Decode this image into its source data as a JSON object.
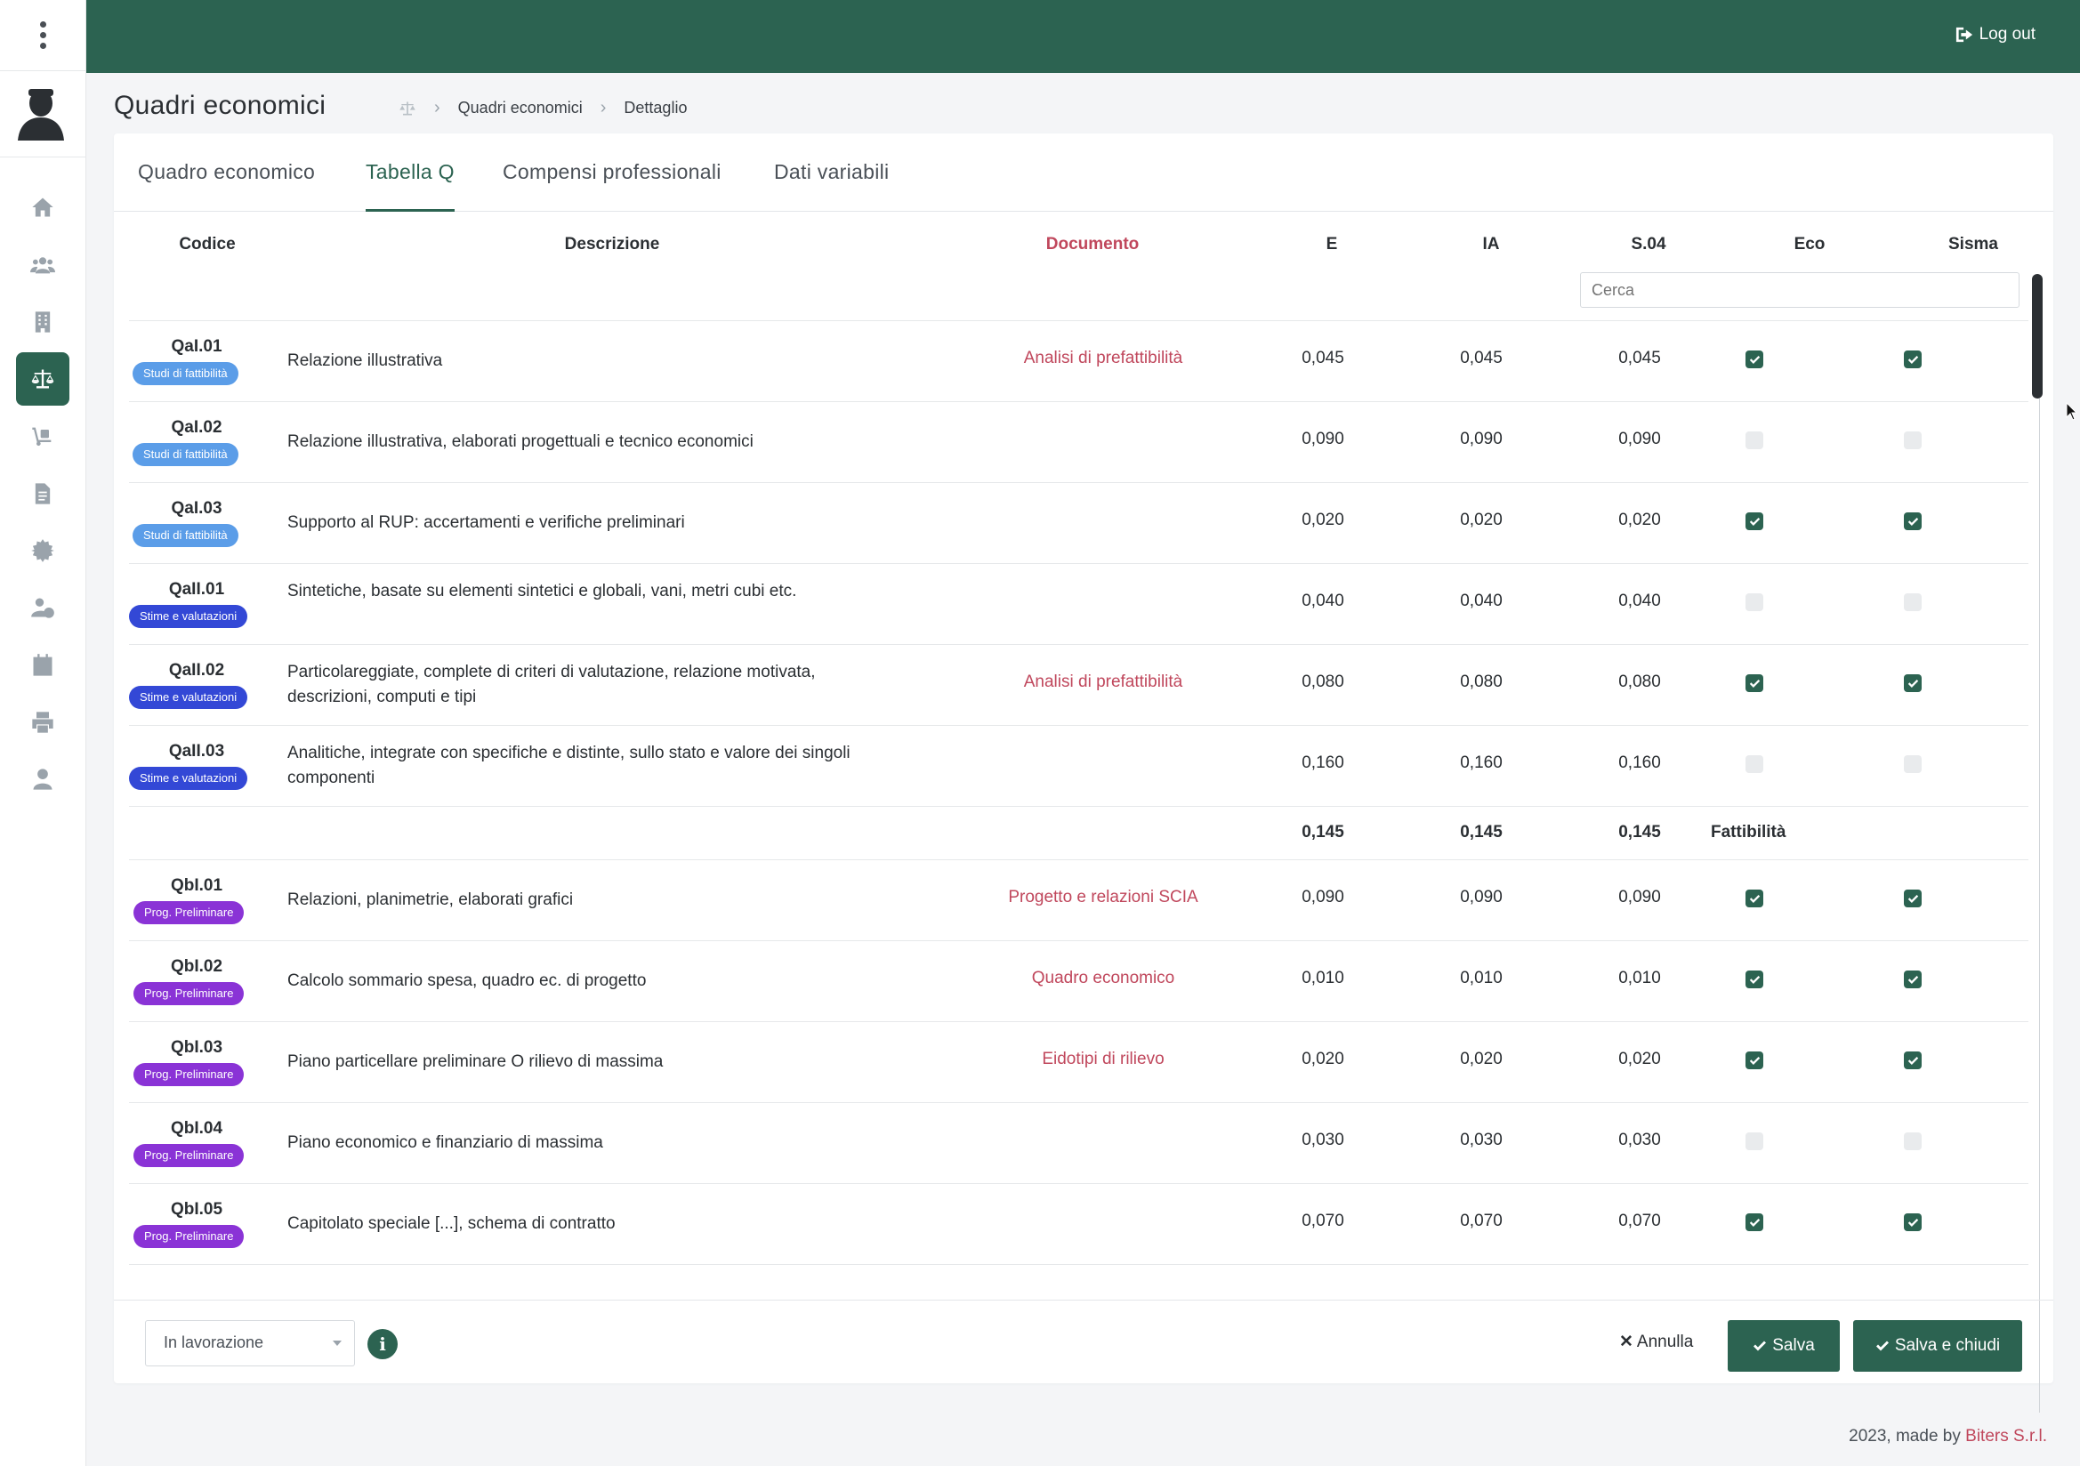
{
  "header": {
    "logout_label": "Log out"
  },
  "page": {
    "title": "Quadri economici",
    "breadcrumb": [
      "Quadri economici",
      "Dettaglio"
    ]
  },
  "tabs": [
    {
      "label": "Quadro economico",
      "active": false
    },
    {
      "label": "Tabella Q",
      "active": true
    },
    {
      "label": "Compensi professionali",
      "active": false
    },
    {
      "label": "Dati variabili",
      "active": false
    }
  ],
  "table": {
    "columns": {
      "codice": "Codice",
      "descrizione": "Descrizione",
      "documento": "Documento",
      "e": "E",
      "ia": "IA",
      "s04": "S.04",
      "eco": "Eco",
      "sisma": "Sisma"
    },
    "search_placeholder": "Cerca",
    "rows": [
      {
        "code": "QaI.01",
        "badge": "Studi di fattibilità",
        "desc": "Relazione illustrativa",
        "doc": "Analisi di prefattibilità",
        "e": "0,045",
        "ia": "0,045",
        "s04": "0,045",
        "eco": true,
        "sisma": true
      },
      {
        "code": "QaI.02",
        "badge": "Studi di fattibilità",
        "desc": "Relazione illustrativa, elaborati progettuali e tecnico economici",
        "doc": "",
        "e": "0,090",
        "ia": "0,090",
        "s04": "0,090",
        "eco": false,
        "sisma": false
      },
      {
        "code": "QaI.03",
        "badge": "Studi di fattibilità",
        "desc": "Supporto al RUP: accertamenti e verifiche preliminari",
        "doc": "",
        "e": "0,020",
        "ia": "0,020",
        "s04": "0,020",
        "eco": true,
        "sisma": true
      },
      {
        "code": "QaII.01",
        "badge": "Stime e valutazioni",
        "desc": "Sintetiche, basate su elementi sintetici e globali, vani, metri cubi etc.",
        "doc": "",
        "e": "0,040",
        "ia": "0,040",
        "s04": "0,040",
        "eco": false,
        "sisma": false
      },
      {
        "code": "QaII.02",
        "badge": "Stime e valutazioni",
        "desc": "Particolareggiate, complete di criteri di valutazione, relazione motivata, descrizioni, computi e tipi",
        "doc": "Analisi di prefattibilità",
        "e": "0,080",
        "ia": "0,080",
        "s04": "0,080",
        "eco": true,
        "sisma": true
      },
      {
        "code": "QaII.03",
        "badge": "Stime e valutazioni",
        "desc": "Analitiche, integrate con specifiche e distinte, sullo stato e valore dei singoli componenti",
        "doc": "",
        "e": "0,160",
        "ia": "0,160",
        "s04": "0,160",
        "eco": false,
        "sisma": false
      }
    ],
    "subtotal": {
      "e": "0,145",
      "ia": "0,145",
      "s04": "0,145",
      "label": "Fattibilità"
    },
    "rows2": [
      {
        "code": "QbI.01",
        "badge": "Prog. Preliminare",
        "desc": "Relazioni, planimetrie, elaborati grafici",
        "doc": "Progetto e relazioni SCIA",
        "e": "0,090",
        "ia": "0,090",
        "s04": "0,090",
        "eco": true,
        "sisma": true
      },
      {
        "code": "QbI.02",
        "badge": "Prog. Preliminare",
        "desc": "Calcolo sommario spesa, quadro ec. di progetto",
        "doc": "Quadro economico",
        "e": "0,010",
        "ia": "0,010",
        "s04": "0,010",
        "eco": true,
        "sisma": true
      },
      {
        "code": "QbI.03",
        "badge": "Prog. Preliminare",
        "desc": "Piano particellare preliminare O rilievo di massima",
        "doc": "Eidotipi di rilievo",
        "e": "0,020",
        "ia": "0,020",
        "s04": "0,020",
        "eco": true,
        "sisma": true
      },
      {
        "code": "QbI.04",
        "badge": "Prog. Preliminare",
        "desc": "Piano economico e finanziario di massima",
        "doc": "",
        "e": "0,030",
        "ia": "0,030",
        "s04": "0,030",
        "eco": false,
        "sisma": false
      },
      {
        "code": "QbI.05",
        "badge": "Prog. Preliminare",
        "desc": "Capitolato speciale [...], schema di contratto",
        "doc": "",
        "e": "0,070",
        "ia": "0,070",
        "s04": "0,070",
        "eco": true,
        "sisma": true
      }
    ]
  },
  "badge_colors": {
    "Studi di fattibilità": "#5b9de8",
    "Stime e valutazioni": "#3348d6",
    "Prog. Preliminare": "#8a33d6"
  },
  "footer": {
    "status_value": "In lavorazione",
    "info_icon": "i",
    "cancel_label": "Annulla",
    "save_label": "Salva",
    "save_close_label": "Salva e chiudi"
  },
  "copyright": {
    "text": "2023, made by ",
    "brand": "Biters S.r.l."
  },
  "colors": {
    "accent": "#2c6351",
    "link": "#c0475c"
  }
}
